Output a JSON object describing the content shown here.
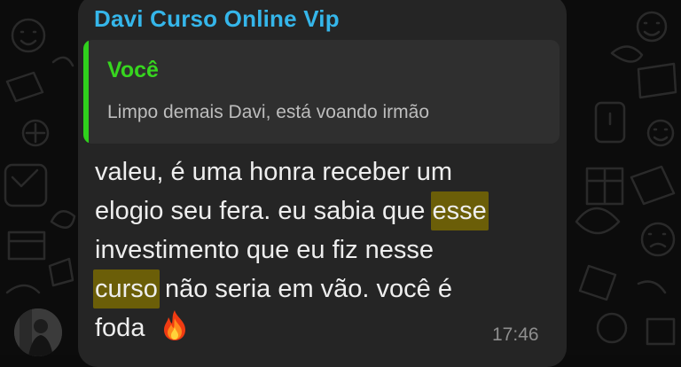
{
  "message": {
    "sender_name": "Davi Curso Online Vip",
    "reply": {
      "author": "Você",
      "text": "Limpo demais Davi, está voando irmão"
    },
    "lines": [
      {
        "text": "valeu, é uma honra receber um"
      },
      {
        "before": "elogio seu fera. eu sabia que ",
        "highlight": "esse"
      },
      {
        "text": "investimento que eu fiz nesse"
      },
      {
        "highlight": "curso",
        "after": " não seria em vão. você é"
      },
      {
        "text": "foda "
      }
    ],
    "emoji": "fire-icon",
    "timestamp": "17:46"
  },
  "colors": {
    "background": "#0c0c0c",
    "bubble": "#252525",
    "quote_background": "#2f2f2f",
    "sender_name": "#35b6ea",
    "reply_accent": "#2fd11c",
    "search_highlight": "#6b5e08",
    "timestamp": "#8e8e8e"
  }
}
